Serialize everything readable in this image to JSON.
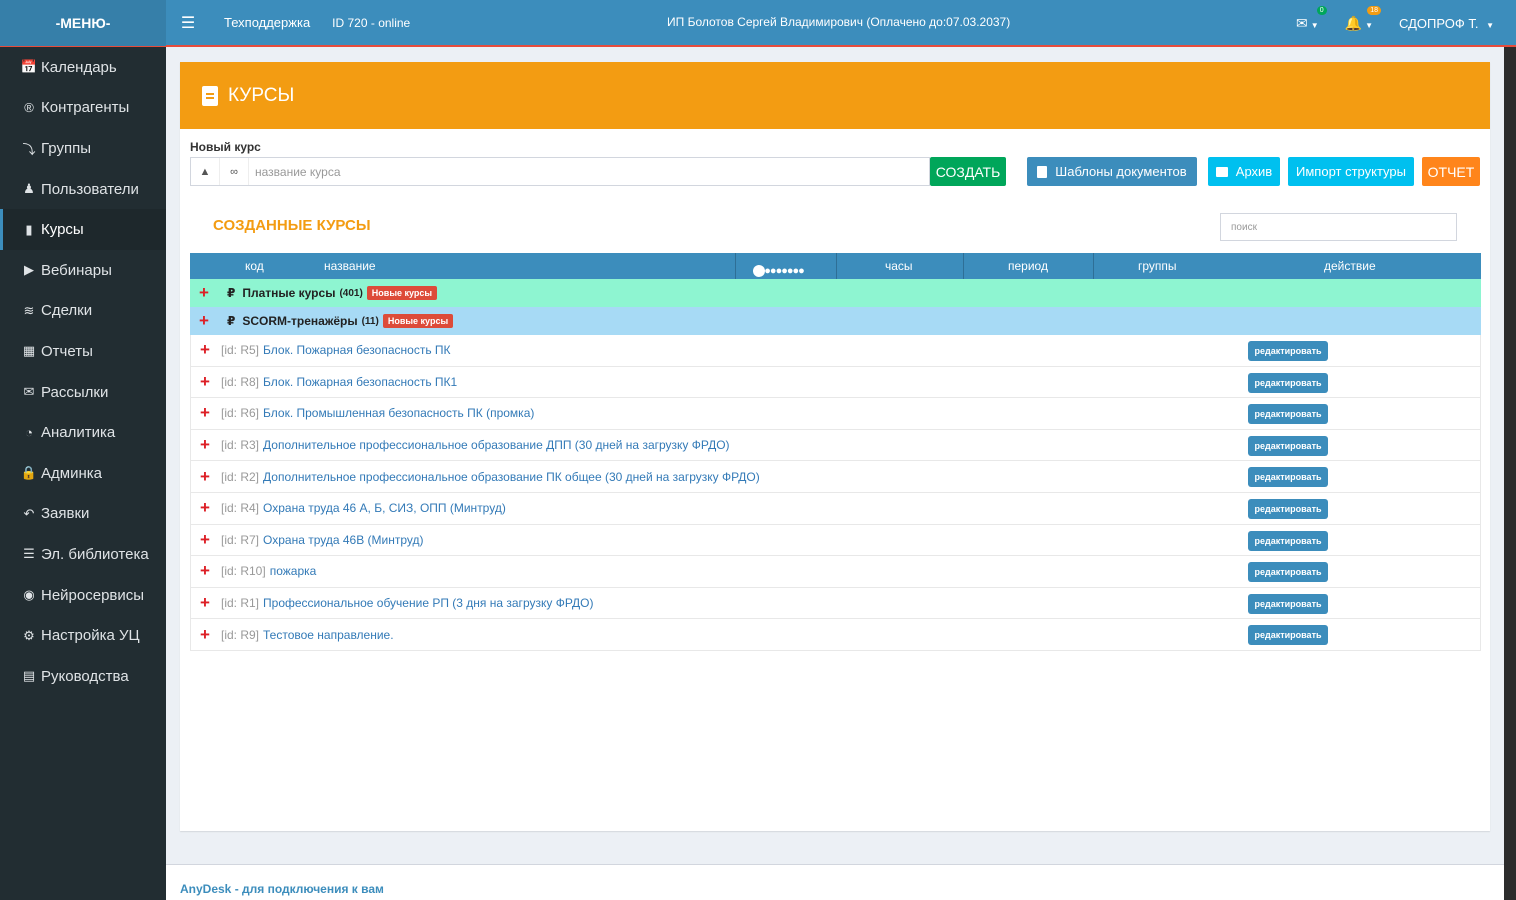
{
  "header": {
    "brand": "-МЕНЮ-",
    "support": "Техподдержка",
    "id_status": "ID 720 - online",
    "company": "ИП Болотов Сергей Владимирович (Оплачено до:07.03.2037)",
    "mail_badge": "0",
    "bell_badge": "18",
    "user": "СДОПРОФ Т."
  },
  "sidebar": {
    "items": [
      {
        "label": "Календарь",
        "icon": "calendar-icon"
      },
      {
        "label": "Контрагенты",
        "icon": "registered-icon"
      },
      {
        "label": "Группы",
        "icon": "share-icon"
      },
      {
        "label": "Пользователи",
        "icon": "users-icon"
      },
      {
        "label": "Курсы",
        "icon": "book-icon"
      },
      {
        "label": "Вебинары",
        "icon": "video-icon"
      },
      {
        "label": "Сделки",
        "icon": "handshake-icon"
      },
      {
        "label": "Отчеты",
        "icon": "file-icon"
      },
      {
        "label": "Рассылки",
        "icon": "envelope-icon"
      },
      {
        "label": "Аналитика",
        "icon": "pie-chart-icon"
      },
      {
        "label": "Админка",
        "icon": "lock-icon"
      },
      {
        "label": "Заявки",
        "icon": "reply-icon"
      },
      {
        "label": "Эл. библиотека",
        "icon": "list-icon"
      },
      {
        "label": "Нейросервисы",
        "icon": "brain-icon"
      },
      {
        "label": "Настройка УЦ",
        "icon": "gears-icon"
      },
      {
        "label": "Руководства",
        "icon": "newspaper-icon"
      }
    ]
  },
  "page": {
    "title": "КУРСЫ",
    "new_course_label": "Новый курс",
    "input_placeholder": "название курса",
    "btn_create": "СОЗДАТЬ",
    "btn_templates": "Шаблоны документов",
    "btn_archive": "Архив",
    "btn_import": "Импорт структуры",
    "btn_report": "ОТЧЕТ",
    "section_title": "СОЗДАННЫЕ КУРСЫ",
    "search_placeholder": "поиск"
  },
  "table": {
    "headers": {
      "code": "код",
      "name": "название",
      "dots": "●●●●●●●●●",
      "hours": "часы",
      "period": "период",
      "groups": "группы",
      "action": "действие"
    },
    "groups": [
      {
        "name": "Платные курсы",
        "count": "(401)",
        "tag": "Новые курсы"
      },
      {
        "name": "SCORM-тренажёры",
        "count": "(11)",
        "tag": "Новые курсы"
      }
    ],
    "rows": [
      {
        "id": "[id: R5]",
        "name": "Блок. Пожарная безопасность ПК"
      },
      {
        "id": "[id: R8]",
        "name": "Блок. Пожарная безопасность ПК1"
      },
      {
        "id": "[id: R6]",
        "name": "Блок. Промышленная безопасность ПК (промка)"
      },
      {
        "id": "[id: R3]",
        "name": "Дополнительное профессиональное образование ДПП (30 дней на загрузку ФРДО)"
      },
      {
        "id": "[id: R2]",
        "name": "Дополнительное профессиональное образование ПК общее (30 дней на загрузку ФРДО)"
      },
      {
        "id": "[id: R4]",
        "name": "Охрана труда 46 А, Б, СИЗ, ОПП (Минтруд)"
      },
      {
        "id": "[id: R7]",
        "name": "Охрана труда 46В (Минтруд)"
      },
      {
        "id": "[id: R10]",
        "name": "пожарка"
      },
      {
        "id": "[id: R1]",
        "name": "Профессиональное обучение РП (3 дня на загрузку ФРДО)"
      },
      {
        "id": "[id: R9]",
        "name": "Тестовое направление."
      }
    ],
    "edit_label": "редактировать"
  },
  "footer": {
    "text": "AnyDesk - для подключения к вам"
  }
}
